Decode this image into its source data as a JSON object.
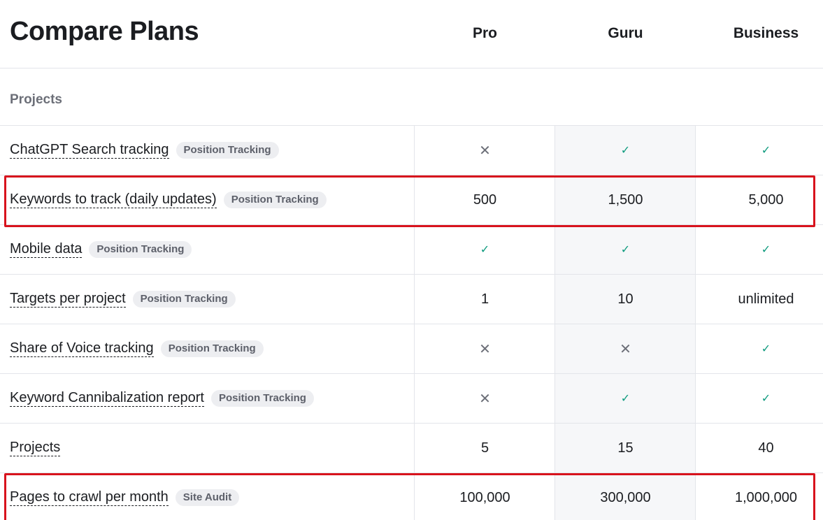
{
  "page_title": "Compare Plans",
  "plans": [
    "Pro",
    "Guru",
    "Business"
  ],
  "section_title": "Projects",
  "colors": {
    "check": "#0e9b7e",
    "cross": "#6c6f78",
    "highlight": "#d8131d",
    "tag_bg": "#edeef1"
  },
  "rows": [
    {
      "feature": "ChatGPT Search tracking",
      "tag": "Position Tracking",
      "values": [
        {
          "icon": "cross-icon",
          "text": "✕"
        },
        {
          "icon": "check-icon",
          "text": "✓"
        },
        {
          "icon": "check-icon",
          "text": "✓"
        }
      ]
    },
    {
      "feature": "Keywords to track (daily updates)",
      "tag": "Position Tracking",
      "highlighted": true,
      "values": [
        {
          "text": "500"
        },
        {
          "text": "1,500"
        },
        {
          "text": "5,000"
        }
      ]
    },
    {
      "feature": "Mobile data",
      "tag": "Position Tracking",
      "values": [
        {
          "icon": "check-icon",
          "text": "✓"
        },
        {
          "icon": "check-icon",
          "text": "✓"
        },
        {
          "icon": "check-icon",
          "text": "✓"
        }
      ]
    },
    {
      "feature": "Targets per project",
      "tag": "Position Tracking",
      "values": [
        {
          "text": "1"
        },
        {
          "text": "10"
        },
        {
          "text": "unlimited"
        }
      ]
    },
    {
      "feature": "Share of Voice tracking",
      "tag": "Position Tracking",
      "values": [
        {
          "icon": "cross-icon",
          "text": "✕"
        },
        {
          "icon": "cross-icon",
          "text": "✕"
        },
        {
          "icon": "check-icon",
          "text": "✓"
        }
      ]
    },
    {
      "feature": "Keyword Cannibalization report",
      "tag": "Position Tracking",
      "values": [
        {
          "icon": "cross-icon",
          "text": "✕"
        },
        {
          "icon": "check-icon",
          "text": "✓"
        },
        {
          "icon": "check-icon",
          "text": "✓"
        }
      ]
    },
    {
      "feature": "Projects",
      "tag": "",
      "values": [
        {
          "text": "5"
        },
        {
          "text": "15"
        },
        {
          "text": "40"
        }
      ]
    },
    {
      "feature": "Pages to crawl per month",
      "tag": "Site Audit",
      "highlighted": true,
      "values": [
        {
          "text": "100,000"
        },
        {
          "text": "300,000"
        },
        {
          "text": "1,000,000"
        }
      ]
    }
  ]
}
